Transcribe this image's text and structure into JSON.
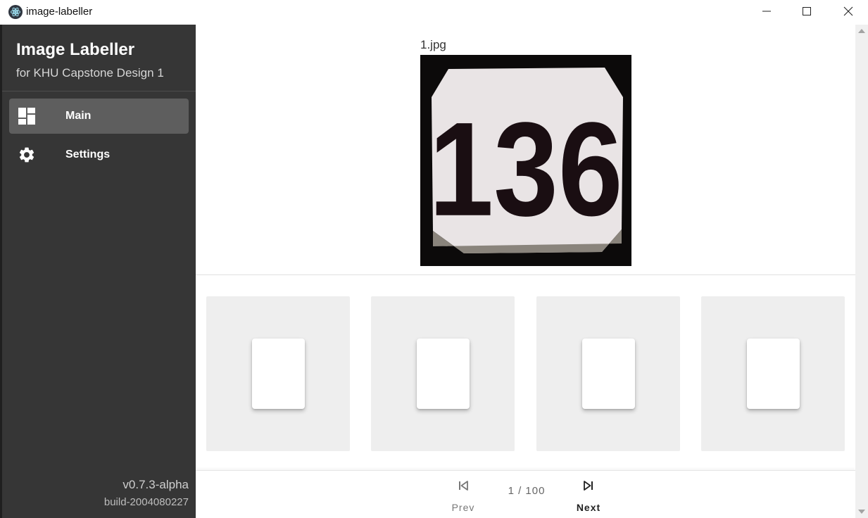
{
  "window": {
    "title": "image-labeller",
    "controls": [
      "minimize-icon",
      "maximize-icon",
      "close-icon"
    ]
  },
  "sidebar": {
    "app_name": "Image Labeller",
    "subtitle": "for KHU Capstone Design 1",
    "items": [
      {
        "label": "Main",
        "icon": "dashboard-icon",
        "active": true
      },
      {
        "label": "Settings",
        "icon": "gear-icon",
        "active": false
      }
    ],
    "version": "v0.7.3-alpha",
    "build": "build-2004080227"
  },
  "main": {
    "filename": "1.jpg",
    "image_text": "136",
    "cards": [
      {
        "icon": "blank-document"
      },
      {
        "icon": "blank-document"
      },
      {
        "icon": "blank-document"
      },
      {
        "icon": "blank-document"
      }
    ]
  },
  "pagination": {
    "prev_label": "Prev",
    "next_label": "Next",
    "indicator": "1 / 100"
  },
  "colors": {
    "sidebar_bg": "#363636",
    "sidebar_active": "#5e5e5e",
    "card_bg": "#eeeeee"
  }
}
